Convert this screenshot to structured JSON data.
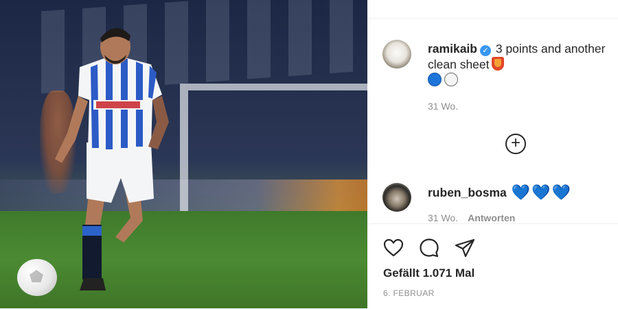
{
  "post": {
    "author": "ramikaib",
    "caption": "3 points and another clean sheet",
    "caption_time": "31 Wo.",
    "likes": "Gefällt 1.071 Mal",
    "date": "6. FEBRUAR"
  },
  "comments": [
    {
      "username": "ruben_bosma",
      "hearts": [
        "💙",
        "💙",
        "💙"
      ],
      "time": "31 Wo.",
      "reply_label": "Antworten"
    }
  ],
  "icons": {
    "verified": "verified-badge-icon",
    "like": "heart-outline-icon",
    "comment": "speech-bubble-icon",
    "share": "paper-plane-icon",
    "load_more": "plus-circle-icon"
  },
  "colors": {
    "verified": "#3897f0",
    "meta_text": "#8e8e8e",
    "primary_text": "#262626",
    "heart_blue": "#1f6fd0"
  }
}
